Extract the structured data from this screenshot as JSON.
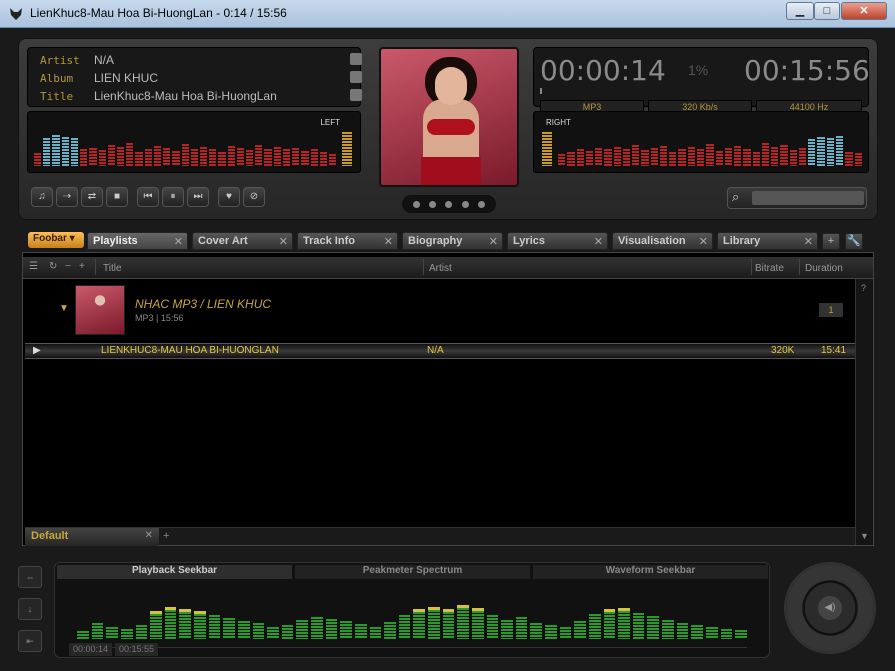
{
  "window": {
    "title": "LienKhuc8-Mau Hoa Bi-HuongLan - 0:14 / 15:56",
    "min": "▁",
    "max": "□",
    "close": "✕"
  },
  "meta": {
    "artist_label": "Artist",
    "artist": "N/A",
    "album_label": "Album",
    "album": "LIEN KHUC",
    "title_label": "Title",
    "title": "LienKhuc8-Mau Hoa Bi-HuongLan"
  },
  "spectrum": {
    "left_label": "LEFT",
    "right_label": "RIGHT"
  },
  "transport": [
    "♫",
    "⇢",
    "⇄",
    "■",
    "⏮",
    "⏸",
    "⏭",
    "♥",
    "⊘"
  ],
  "time": {
    "elapsed": "00:00:14",
    "percent": "1%",
    "total": "00:15:56",
    "format": "MP3",
    "bitrate": "320 Kb/s",
    "samplerate": "44100 Hz"
  },
  "search": {
    "icon": "search-icon",
    "placeholder": ""
  },
  "tabs": {
    "foobar": "Foobar ▾",
    "items": [
      "Playlists",
      "Cover Art",
      "Track Info",
      "Biography",
      "Lyrics",
      "Visualisation",
      "Library"
    ],
    "close": "✕",
    "add": "+",
    "wrench": "🔧"
  },
  "playlist": {
    "columns": {
      "title": "Title",
      "artist": "Artist",
      "bitrate": "Bitrate",
      "duration": "Duration"
    },
    "header_icons": [
      "☰",
      "↻",
      "−",
      "+"
    ],
    "help": "?",
    "group": {
      "title": "NHAC MP3 / LIEN KHUC",
      "sub": "MP3 | 15:56",
      "count": "1"
    },
    "track": {
      "play": "▶",
      "title": "LIENKHUC8-MAU HOA BI-HUONGLAN",
      "artist": "N/A",
      "bitrate": "320K",
      "duration": "15:41"
    },
    "footer": {
      "tab": "Default",
      "close": "✕",
      "add": "+",
      "scroll_down": "▼"
    }
  },
  "bottom": {
    "side_buttons": [
      "⇔",
      "↓",
      "⇤"
    ],
    "seek_tabs": [
      "Playback Seekbar",
      "Peakmeter Spectrum",
      "Waveform Seekbar"
    ],
    "time_elapsed": "00:00:14",
    "time_total": "00:15:55",
    "knob_icon": "speaker-icon"
  }
}
